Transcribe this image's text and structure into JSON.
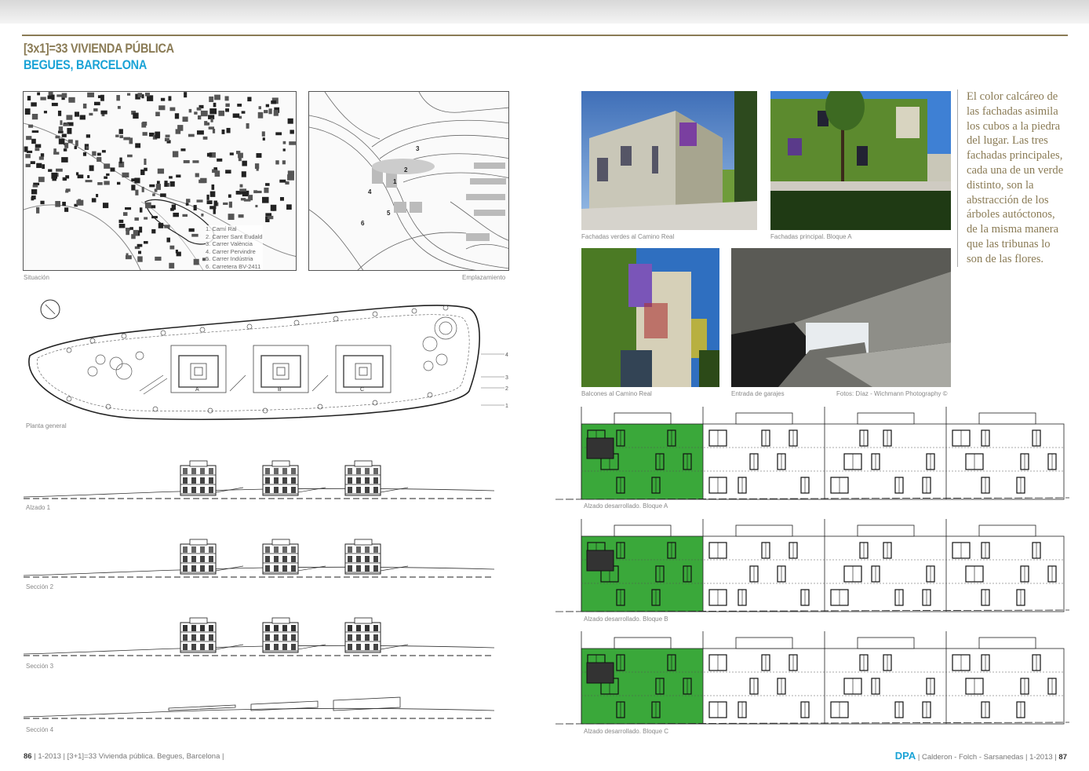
{
  "header": {
    "title_line1": "[3x1]=33 VIVIENDA PÚBLICA",
    "title_line2": "BEGUES, BARCELONA"
  },
  "maps": {
    "situation_caption": "Situación",
    "site_caption": "Emplazamiento",
    "legend": [
      "1. Camí Ral",
      "2. Carrer Sant Eudald",
      "3. Carrer València",
      "4. Carrer Pervindre",
      "5. Carrer Indústria",
      "6. Carretera BV-2411"
    ],
    "site_numbers": [
      "1",
      "2",
      "3",
      "4",
      "5",
      "6"
    ]
  },
  "plan": {
    "caption": "Planta general",
    "blocks": [
      "A",
      "B",
      "C"
    ],
    "level_marks": [
      "4",
      "3",
      "2",
      "1"
    ]
  },
  "elevations": {
    "alzado1": "Alzado 1",
    "seccion2": "Sección 2",
    "seccion3": "Sección 3",
    "seccion4": "Sección 4"
  },
  "photos": {
    "p1_caption": "Fachadas verdes al Camino Real",
    "p2_caption": "Fachadas principal. Bloque A",
    "p3_caption": "Balcones al Camino Real",
    "p4_caption": "Entrada de garajes",
    "credit": "Fotos: Díaz - Wichmann Photography ©"
  },
  "developed": {
    "block_a": "Alzado desarrollado. Bloque A",
    "block_b": "Alzado desarrollado. Bloque B",
    "block_c": "Alzado desarrollado. Bloque C"
  },
  "sidetext": "El color calcáreo de las fachadas asimila los cubos a la piedra del lugar. Las tres fachadas principales, cada una de un verde distinto, son la abstracción de los árboles autóctonos, de la misma manera que las tribunas lo son de las flores.",
  "footer": {
    "left_page": "86",
    "left_text": "| 1-2013 | [3+1]=33 Vivienda pública. Begues, Barcelona |",
    "magazine": "DPA",
    "right_text": "| Calderon - Folch - Sarsanedas | 1-2013 |",
    "right_page": "87"
  },
  "colors": {
    "title_gold": "#8a7b55",
    "title_blue": "#1aa3d6",
    "facade_green": "#3aa83a"
  }
}
